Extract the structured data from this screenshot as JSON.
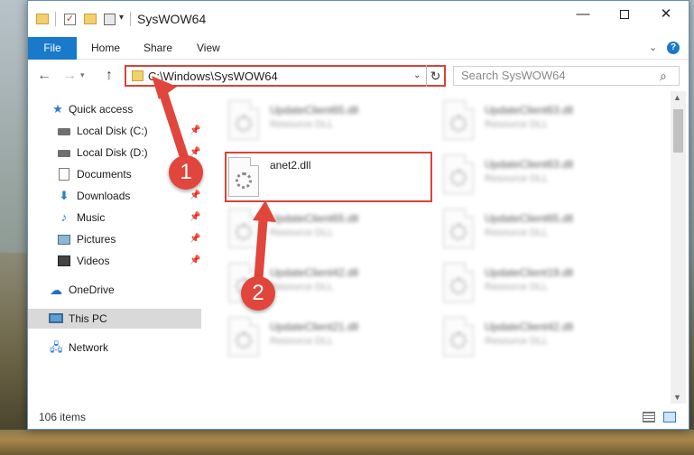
{
  "window": {
    "title": "SysWOW64",
    "minimize_glyph": "—",
    "close_glyph": "✕"
  },
  "ribbon": {
    "tabs": [
      "File",
      "Home",
      "Share",
      "View"
    ]
  },
  "address": {
    "path": "C:\\Windows\\SysWOW64"
  },
  "search": {
    "placeholder": "Search SysWOW64"
  },
  "sidebar": {
    "items": [
      {
        "label": "Quick access",
        "icon": "star-icon"
      },
      {
        "label": "Local Disk (C:)",
        "icon": "drive-icon",
        "pinned": true
      },
      {
        "label": "Local Disk (D:)",
        "icon": "drive-icon",
        "pinned": true
      },
      {
        "label": "Documents",
        "icon": "documents-icon",
        "pinned": true
      },
      {
        "label": "Downloads",
        "icon": "downloads-icon",
        "pinned": true
      },
      {
        "label": "Music",
        "icon": "music-icon",
        "pinned": true
      },
      {
        "label": "Pictures",
        "icon": "pictures-icon",
        "pinned": true
      },
      {
        "label": "Videos",
        "icon": "videos-icon",
        "pinned": true
      },
      {
        "label": "OneDrive",
        "icon": "cloud-icon"
      },
      {
        "label": "This PC",
        "icon": "computer-icon",
        "selected": true
      },
      {
        "label": "Network",
        "icon": "network-icon"
      }
    ]
  },
  "files": [
    {
      "name": "UpdateClient65.dll",
      "type": "Resource DLL",
      "blurred": true
    },
    {
      "name": "UpdateClient63.dll",
      "type": "Resource DLL",
      "blurred": true
    },
    {
      "name": "anet2.dll",
      "type": "",
      "blurred": false,
      "highlighted": true
    },
    {
      "name": "UpdateClient63.dll",
      "type": "Resource DLL",
      "blurred": true
    },
    {
      "name": "UpdateClient65.dll",
      "type": "Resource DLL",
      "blurred": true
    },
    {
      "name": "UpdateClient65.dll",
      "type": "Resource DLL",
      "blurred": true
    },
    {
      "name": "UpdateClient42.dll",
      "type": "Resource DLL",
      "blurred": true
    },
    {
      "name": "UpdateClient19.dll",
      "type": "Resource DLL",
      "blurred": true
    },
    {
      "name": "UpdateClient21.dll",
      "type": "Resource DLL",
      "blurred": true
    },
    {
      "name": "UpdateClient42.dll",
      "type": "Resource DLL",
      "blurred": true
    }
  ],
  "status": {
    "item_count": "106 items"
  },
  "annotations": {
    "step1": "1",
    "step2": "2",
    "color": "#e0463b"
  }
}
